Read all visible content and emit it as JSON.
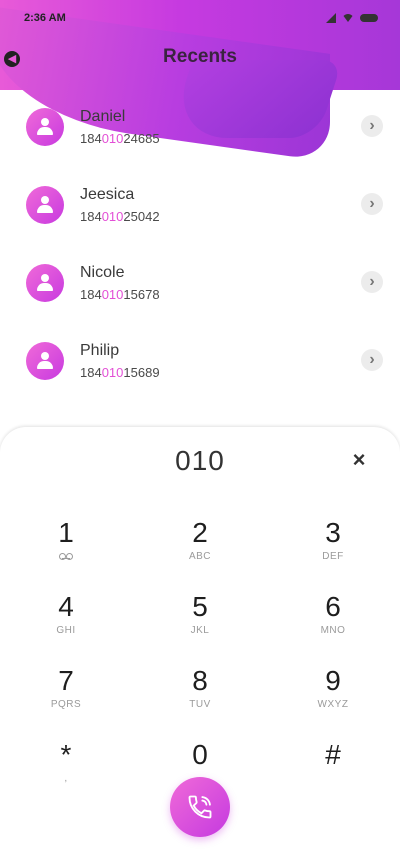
{
  "status_bar": {
    "time": "2:36 AM"
  },
  "header": {
    "title": "Recents"
  },
  "contacts": [
    {
      "name": "Daniel",
      "num_pre": "184",
      "num_match": "010",
      "num_post": "24685"
    },
    {
      "name": "Jeesica",
      "num_pre": "184",
      "num_match": "010",
      "num_post": "25042"
    },
    {
      "name": "Nicole",
      "num_pre": "184",
      "num_match": "010",
      "num_post": "15678"
    },
    {
      "name": "Philip",
      "num_pre": "184",
      "num_match": "010",
      "num_post": "15689"
    }
  ],
  "dialpad": {
    "entered": "010",
    "clear_symbol": "×",
    "keys": [
      {
        "digit": "1",
        "letters": ""
      },
      {
        "digit": "2",
        "letters": "ABC"
      },
      {
        "digit": "3",
        "letters": "DEF"
      },
      {
        "digit": "4",
        "letters": "GHI"
      },
      {
        "digit": "5",
        "letters": "JKL"
      },
      {
        "digit": "6",
        "letters": "MNO"
      },
      {
        "digit": "7",
        "letters": "PQRS"
      },
      {
        "digit": "8",
        "letters": "TUV"
      },
      {
        "digit": "9",
        "letters": "WXYZ"
      },
      {
        "digit": "*",
        "letters": ","
      },
      {
        "digit": "0",
        "letters": ""
      },
      {
        "digit": "#",
        "letters": ""
      }
    ]
  },
  "icons": {
    "back": "back-arrow-icon",
    "chevron": "chevron-right-icon",
    "voicemail": "voicemail-icon",
    "call": "phone-call-icon",
    "avatar": "person-icon"
  },
  "colors": {
    "accent": "#e34fd6",
    "header_start": "#e85ad8",
    "header_end": "#a637d8"
  }
}
